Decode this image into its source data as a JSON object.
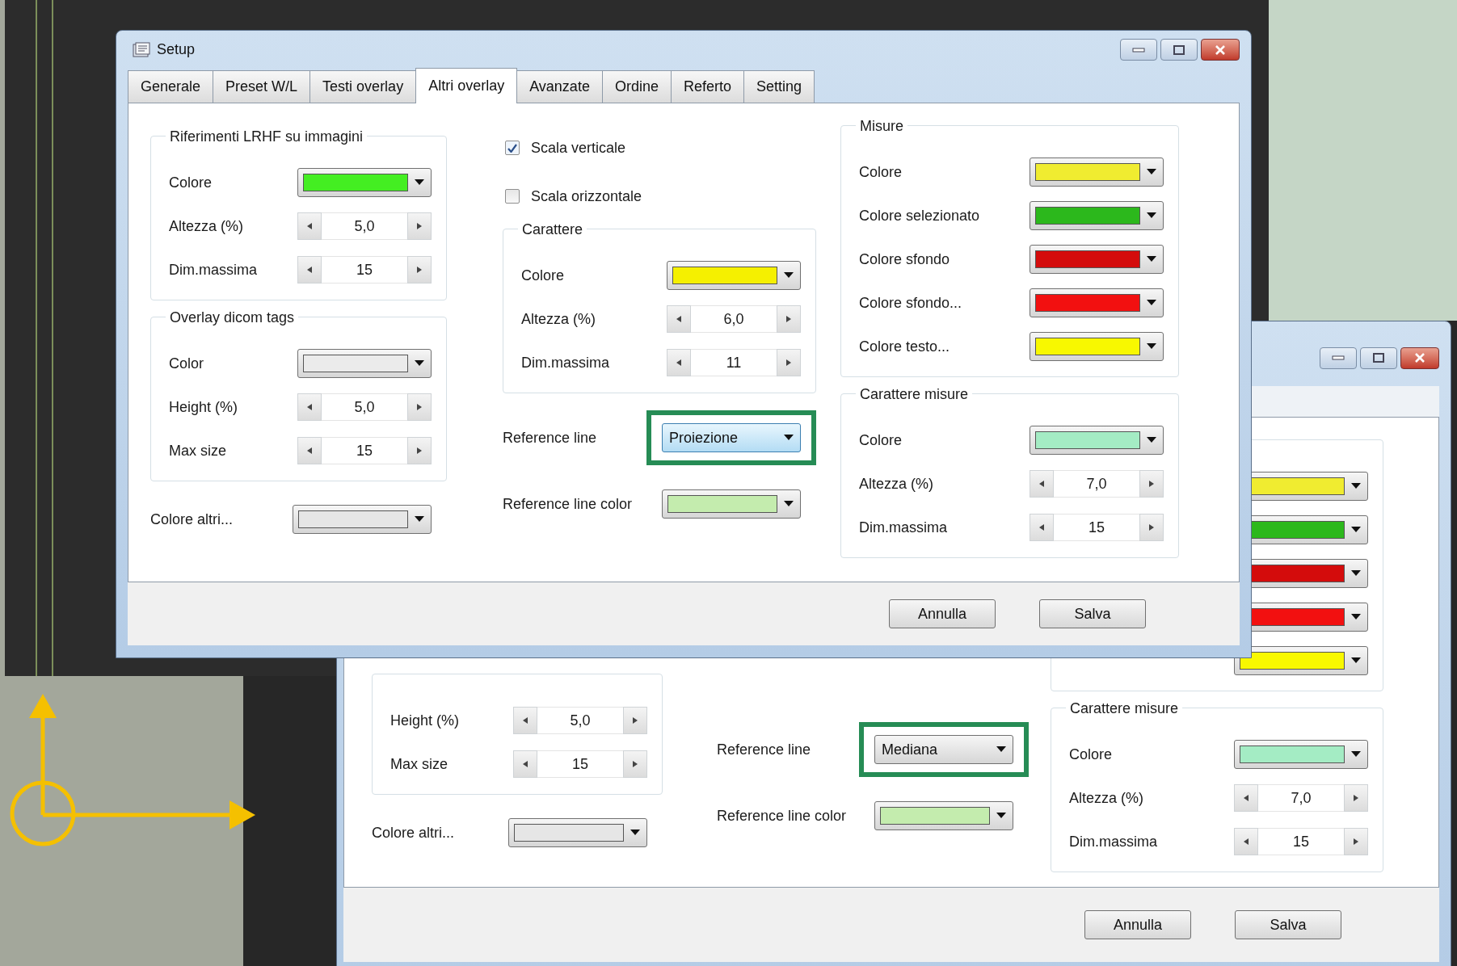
{
  "front_window": {
    "title": "Setup",
    "tabs": [
      {
        "label": "Generale",
        "selected": false
      },
      {
        "label": "Preset W/L",
        "selected": false
      },
      {
        "label": "Testi overlay",
        "selected": false
      },
      {
        "label": "Altri overlay",
        "selected": true
      },
      {
        "label": "Avanzate",
        "selected": false
      },
      {
        "label": "Ordine",
        "selected": false
      },
      {
        "label": "Referto",
        "selected": false
      },
      {
        "label": "Setting",
        "selected": false
      }
    ],
    "columns": [
      [
        {
          "kind": "group",
          "title": "Riferimenti LRHF su immagini",
          "rows": [
            {
              "kind": "color",
              "label": "Colore",
              "color": "#44ee22"
            },
            {
              "kind": "spin",
              "label": "Altezza (%)",
              "value": "5,0"
            },
            {
              "kind": "spin",
              "label": "Dim.massima",
              "value": "15"
            }
          ]
        },
        {
          "kind": "group",
          "title": "Overlay dicom tags",
          "rows": [
            {
              "kind": "color",
              "label": "Color",
              "color": "#ebebeb"
            },
            {
              "kind": "spin",
              "label": "Height (%)",
              "value": "5,0"
            },
            {
              "kind": "spin",
              "label": "Max size",
              "value": "15"
            }
          ]
        },
        {
          "kind": "color",
          "label": "Colore altri...",
          "color": "#e6e6e6"
        }
      ],
      [
        {
          "kind": "checkbox",
          "label": "Scala verticale",
          "checked": true
        },
        {
          "kind": "checkbox",
          "label": "Scala orizzontale",
          "checked": false
        },
        {
          "kind": "group",
          "title": "Carattere",
          "rows": [
            {
              "kind": "color",
              "label": "Colore",
              "color": "#f5f000"
            },
            {
              "kind": "spin",
              "label": "Altezza (%)",
              "value": "6,0"
            },
            {
              "kind": "spin",
              "label": "Dim.massima",
              "value": "11"
            }
          ]
        },
        {
          "kind": "select",
          "label": "Reference line",
          "value": "Proiezione",
          "highlighted": true,
          "focused": true
        },
        {
          "kind": "color",
          "label": "Reference line color",
          "color": "#c4ecae"
        }
      ],
      [
        {
          "kind": "group",
          "title": "Misure",
          "rows": [
            {
              "kind": "color",
              "label": "Colore",
              "color": "#f0ec30"
            },
            {
              "kind": "color",
              "label": "Colore selezionato",
              "color": "#2cb81c"
            },
            {
              "kind": "color",
              "label": "Colore sfondo",
              "color": "#d40c0c"
            },
            {
              "kind": "color",
              "label": "Colore sfondo...",
              "color": "#f21010"
            },
            {
              "kind": "color",
              "label": "Colore testo...",
              "color": "#f8f800"
            }
          ]
        },
        {
          "kind": "group",
          "title": "Carattere misure",
          "rows": [
            {
              "kind": "color",
              "label": "Colore",
              "color": "#a4ecc4"
            },
            {
              "kind": "spin",
              "label": "Altezza (%)",
              "value": "7,0"
            },
            {
              "kind": "spin",
              "label": "Dim.massima",
              "value": "15"
            }
          ]
        }
      ]
    ],
    "buttons": [
      "Annulla",
      "Salva"
    ]
  },
  "back_window": {
    "columns": [
      [
        {
          "kind": "group",
          "rows": [
            {
              "kind": "spin",
              "label": "Height (%)",
              "value": "5,0"
            },
            {
              "kind": "spin",
              "label": "Max size",
              "value": "15"
            }
          ]
        },
        {
          "kind": "color",
          "label": "Colore altri...",
          "color": "#e6e6e6"
        }
      ],
      [
        {
          "kind": "select",
          "label": "Reference line",
          "value": "Mediana",
          "highlighted": true,
          "focused": false
        },
        {
          "kind": "color",
          "label": "Reference line color",
          "color": "#c4ecae"
        }
      ],
      [
        {
          "kind": "group",
          "rows": [
            {
              "kind": "color",
              "color": "#f0ec30"
            },
            {
              "kind": "color",
              "color": "#2cb81c"
            },
            {
              "kind": "color",
              "color": "#d40c0c"
            },
            {
              "kind": "color",
              "color": "#f21010"
            },
            {
              "kind": "color",
              "color": "#f8f800"
            }
          ]
        },
        {
          "kind": "group",
          "title": "Carattere misure",
          "rows": [
            {
              "kind": "color",
              "label": "Colore",
              "color": "#a4ecc4"
            },
            {
              "kind": "spin",
              "label": "Altezza (%)",
              "value": "7,0"
            },
            {
              "kind": "spin",
              "label": "Dim.massima",
              "value": "15"
            }
          ]
        }
      ]
    ],
    "buttons": [
      "Annulla",
      "Salva"
    ]
  }
}
